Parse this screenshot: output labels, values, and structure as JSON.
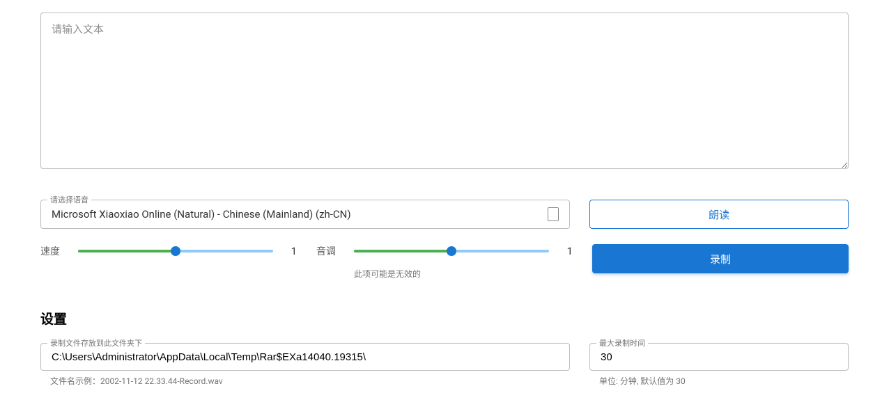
{
  "textInput": {
    "placeholder": "请输入文本",
    "value": ""
  },
  "voiceSelect": {
    "label": "请选择语音",
    "value": "Microsoft Xiaoxiao Online (Natural) - Chinese (Mainland) (zh-CN)"
  },
  "buttons": {
    "read": "朗读",
    "record": "录制"
  },
  "sliders": {
    "speed": {
      "label": "速度",
      "value": "1"
    },
    "pitch": {
      "label": "音调",
      "value": "1",
      "hint": "此项可能是无效的"
    }
  },
  "settings": {
    "title": "设置",
    "folder": {
      "label": "录制文件存放到此文件夹下",
      "value": "C:\\Users\\Administrator\\AppData\\Local\\Temp\\Rar$EXa14040.19315\\",
      "hint": "文件名示例：2002-11-12 22.33.44-Record.wav"
    },
    "maxTime": {
      "label": "最大录制时间",
      "value": "30",
      "hint": "单位: 分钟, 默认值为 30"
    }
  }
}
